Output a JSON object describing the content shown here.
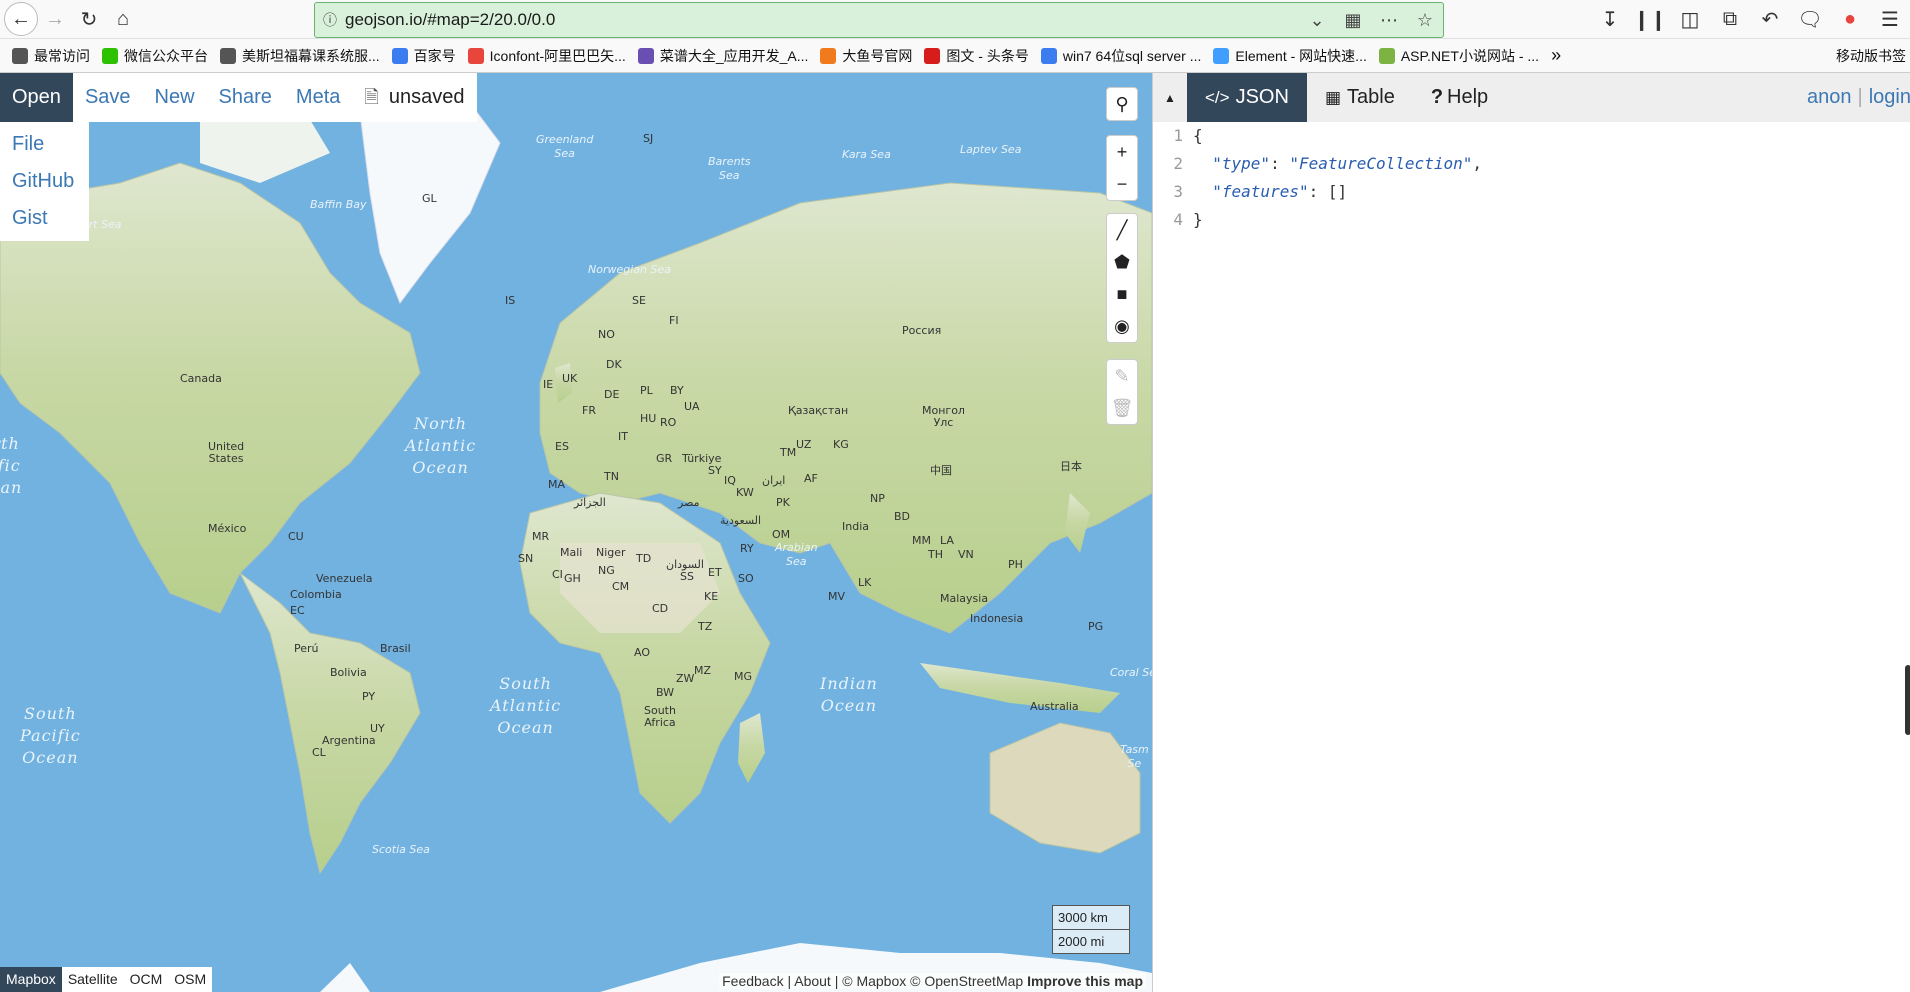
{
  "browser": {
    "url": "geojson.io/#map=2/20.0/0.0",
    "nav_icons": [
      "back-icon",
      "forward-icon",
      "reload-icon",
      "home-icon"
    ],
    "right_icons": [
      "download-icon",
      "library-icon",
      "sidebar-icon",
      "screenshot-icon",
      "undo-icon",
      "chat-icon",
      "pin-icon",
      "menu-icon"
    ]
  },
  "bookmarks": [
    {
      "label": "最常访问",
      "color": "#555"
    },
    {
      "label": "微信公众平台",
      "color": "#2dc100"
    },
    {
      "label": "美斯坦福幕课系统服...",
      "color": "#555"
    },
    {
      "label": "百家号",
      "color": "#3b7cf0"
    },
    {
      "label": "Iconfont-阿里巴巴矢...",
      "color": "#e8453c"
    },
    {
      "label": "菜谱大全_应用开发_A...",
      "color": "#6a4fb3"
    },
    {
      "label": "大鱼号官网",
      "color": "#f07a1c"
    },
    {
      "label": "图文 - 头条号",
      "color": "#d71c1c"
    },
    {
      "label": "win7 64位sql server ...",
      "color": "#3b7cf0"
    },
    {
      "label": "Element - 网站快速...",
      "color": "#409eff"
    },
    {
      "label": "ASP.NET小说网站 - ...",
      "color": "#7cb342"
    }
  ],
  "bookmarks_more": "»",
  "mobile_bookmarks": "移动版书签",
  "topbar": {
    "open": "Open",
    "save": "Save",
    "new": "New",
    "share": "Share",
    "meta": "Meta",
    "unsaved": "unsaved"
  },
  "file_menu": [
    "File",
    "GitHub",
    "Gist"
  ],
  "map": {
    "oceans": [
      {
        "text": "North\nAtlantic\nOcean"
      },
      {
        "text": "South\nAtlantic\nOcean"
      },
      {
        "text": "Indian\nOcean"
      },
      {
        "text": "South\nPacific\nOcean"
      },
      {
        "text": "rth\nific\nean"
      }
    ],
    "seas": [
      "Greenland\nSea",
      "Barents\nSea",
      "Kara Sea",
      "Laptev Sea",
      "Norwegian Sea",
      "Baffin Bay",
      "Beaufort Sea",
      "Arabian\nSea",
      "Coral Se",
      "Scotia Sea",
      "Tasm\nSe"
    ],
    "labels": [
      "GL",
      "SJ",
      "IS",
      "SE",
      "FI",
      "NO",
      "UK",
      "IE",
      "DK",
      "DE",
      "PL",
      "BY",
      "UA",
      "FR",
      "HU",
      "RO",
      "IT",
      "ES",
      "GR",
      "Türkiye",
      "SY",
      "IQ",
      "ایران",
      "KW",
      "AF",
      "PK",
      "TM",
      "UZ",
      "KG",
      "Қазақстан",
      "Россия",
      "Монгол\nУлс",
      "中国",
      "日本",
      "India",
      "NP",
      "BD",
      "MM",
      "LA",
      "TH",
      "VN",
      "PH",
      "Malaysia",
      "Indonesia",
      "PG",
      "Australia",
      "MA",
      "الجزائر",
      "مصر",
      "TN",
      "السعودية",
      "OM",
      "RY",
      "MR",
      "Mali",
      "Niger",
      "TD",
      "السودان",
      "SN",
      "CI",
      "GH",
      "NG",
      "ET",
      "SO",
      "CM",
      "SS",
      "KE",
      "CD",
      "TZ",
      "AO",
      "ZW",
      "MZ",
      "MG",
      "BW",
      "South\nAfrica",
      "Canada",
      "United\nStates",
      "México",
      "CU",
      "Venezuela",
      "Colombia",
      "EC",
      "Perú",
      "Brasil",
      "Bolivia",
      "PY",
      "Argentina",
      "UY",
      "CL",
      "MV",
      "LK"
    ],
    "scale": [
      "3000 km",
      "2000 mi"
    ],
    "layers": [
      "Mapbox",
      "Satellite",
      "OCM",
      "OSM"
    ],
    "attribution": {
      "links": "Feedback | About | © Mapbox © OpenStreetMap",
      "improve": "Improve this map"
    }
  },
  "panel": {
    "tabs": {
      "json": "JSON",
      "table": "Table",
      "help": "Help"
    },
    "auth": {
      "anon": "anon",
      "login": "login"
    },
    "code_lines": [
      {
        "num": "1",
        "text": "{"
      },
      {
        "num": "2",
        "key": "\"type\"",
        "value": "\"FeatureCollection\"",
        "after": ","
      },
      {
        "num": "3",
        "key": "\"features\"",
        "value": "[]",
        "after": ""
      },
      {
        "num": "4",
        "text": "}"
      }
    ]
  }
}
